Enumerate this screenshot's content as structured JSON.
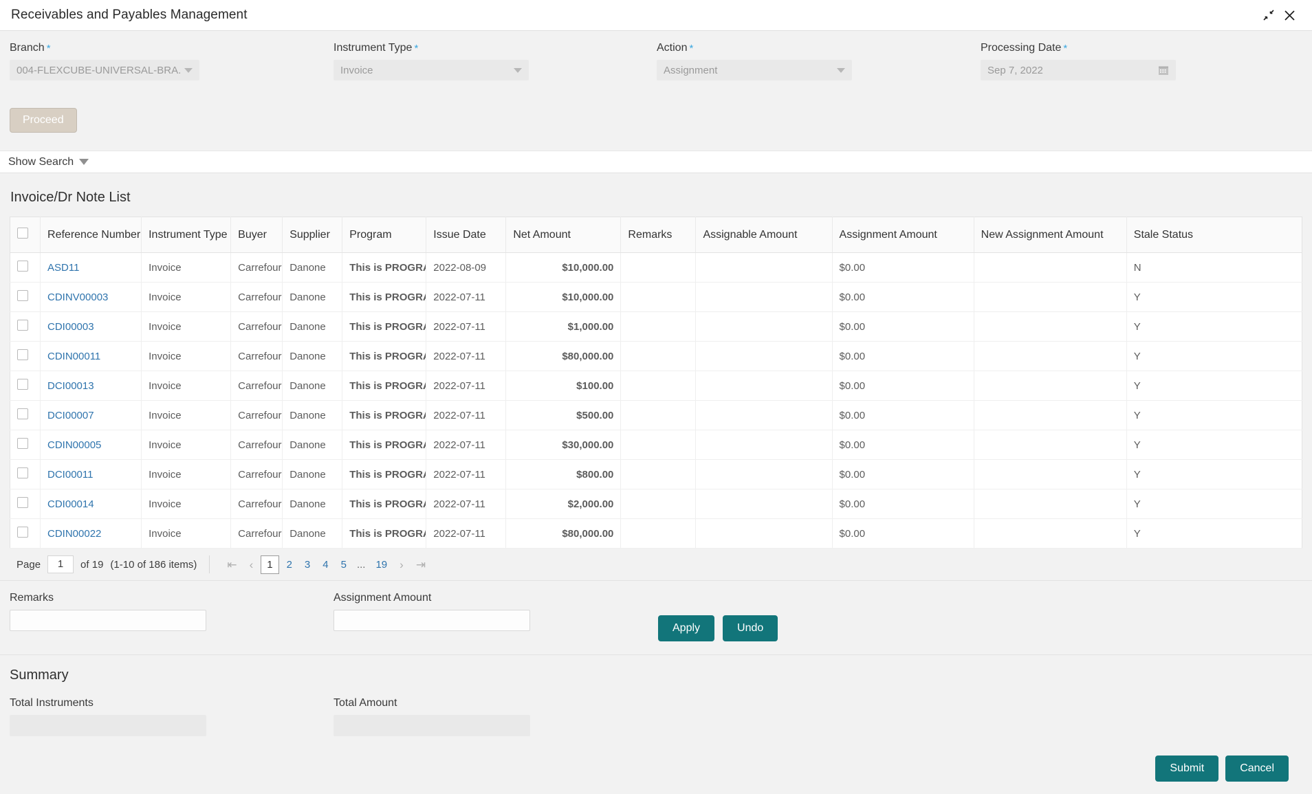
{
  "window": {
    "title": "Receivables and Payables Management",
    "minimize_icon": "collapse-arrows-icon",
    "close_icon": "close-icon"
  },
  "filters": {
    "branch": {
      "label": "Branch",
      "required": "*",
      "value": "004-FLEXCUBE-UNIVERSAL-BRA...",
      "icon": "chevron-down-icon"
    },
    "instrument_type": {
      "label": "Instrument Type",
      "required": "*",
      "value": "Invoice",
      "icon": "chevron-down-icon"
    },
    "action": {
      "label": "Action",
      "required": "*",
      "value": "Assignment",
      "icon": "chevron-down-icon"
    },
    "processing_date": {
      "label": "Processing Date",
      "required": "*",
      "value": "Sep 7, 2022",
      "icon": "calendar-icon"
    },
    "proceed_label": "Proceed"
  },
  "show_search": {
    "label": "Show Search",
    "icon": "triangle-down-icon"
  },
  "list": {
    "title": "Invoice/Dr Note List",
    "columns": [
      "Reference Number",
      "Instrument Type",
      "Buyer",
      "Supplier",
      "Program",
      "Issue Date",
      "Net Amount",
      "Remarks",
      "Assignable Amount",
      "Assignment Amount",
      "New Assignment Amount",
      "Stale Status"
    ],
    "rows": [
      {
        "ref": "ASD11",
        "instrument_type": "Invoice",
        "buyer": "Carrefour",
        "supplier": "Danone",
        "program": "This is PROGRA",
        "issue_date": "2022-08-09",
        "net_amount": "$10,000.00",
        "remarks": "",
        "assignable_amount": "",
        "assignment_amount": "$0.00",
        "new_assignment_amount": "",
        "stale_status": "N"
      },
      {
        "ref": "CDINV00003",
        "instrument_type": "Invoice",
        "buyer": "Carrefour",
        "supplier": "Danone",
        "program": "This is PROGRA",
        "issue_date": "2022-07-11",
        "net_amount": "$10,000.00",
        "remarks": "",
        "assignable_amount": "",
        "assignment_amount": "$0.00",
        "new_assignment_amount": "",
        "stale_status": "Y"
      },
      {
        "ref": "CDI00003",
        "instrument_type": "Invoice",
        "buyer": "Carrefour",
        "supplier": "Danone",
        "program": "This is PROGRA",
        "issue_date": "2022-07-11",
        "net_amount": "$1,000.00",
        "remarks": "",
        "assignable_amount": "",
        "assignment_amount": "$0.00",
        "new_assignment_amount": "",
        "stale_status": "Y"
      },
      {
        "ref": "CDIN00011",
        "instrument_type": "Invoice",
        "buyer": "Carrefour",
        "supplier": "Danone",
        "program": "This is PROGRA",
        "issue_date": "2022-07-11",
        "net_amount": "$80,000.00",
        "remarks": "",
        "assignable_amount": "",
        "assignment_amount": "$0.00",
        "new_assignment_amount": "",
        "stale_status": "Y"
      },
      {
        "ref": "DCI00013",
        "instrument_type": "Invoice",
        "buyer": "Carrefour",
        "supplier": "Danone",
        "program": "This is PROGRA",
        "issue_date": "2022-07-11",
        "net_amount": "$100.00",
        "remarks": "",
        "assignable_amount": "",
        "assignment_amount": "$0.00",
        "new_assignment_amount": "",
        "stale_status": "Y"
      },
      {
        "ref": "DCI00007",
        "instrument_type": "Invoice",
        "buyer": "Carrefour",
        "supplier": "Danone",
        "program": "This is PROGRA",
        "issue_date": "2022-07-11",
        "net_amount": "$500.00",
        "remarks": "",
        "assignable_amount": "",
        "assignment_amount": "$0.00",
        "new_assignment_amount": "",
        "stale_status": "Y"
      },
      {
        "ref": "CDIN00005",
        "instrument_type": "Invoice",
        "buyer": "Carrefour",
        "supplier": "Danone",
        "program": "This is PROGRA",
        "issue_date": "2022-07-11",
        "net_amount": "$30,000.00",
        "remarks": "",
        "assignable_amount": "",
        "assignment_amount": "$0.00",
        "new_assignment_amount": "",
        "stale_status": "Y"
      },
      {
        "ref": "DCI00011",
        "instrument_type": "Invoice",
        "buyer": "Carrefour",
        "supplier": "Danone",
        "program": "This is PROGRA",
        "issue_date": "2022-07-11",
        "net_amount": "$800.00",
        "remarks": "",
        "assignable_amount": "",
        "assignment_amount": "$0.00",
        "new_assignment_amount": "",
        "stale_status": "Y"
      },
      {
        "ref": "CDI00014",
        "instrument_type": "Invoice",
        "buyer": "Carrefour",
        "supplier": "Danone",
        "program": "This is PROGRA",
        "issue_date": "2022-07-11",
        "net_amount": "$2,000.00",
        "remarks": "",
        "assignable_amount": "",
        "assignment_amount": "$0.00",
        "new_assignment_amount": "",
        "stale_status": "Y"
      },
      {
        "ref": "CDIN00022",
        "instrument_type": "Invoice",
        "buyer": "Carrefour",
        "supplier": "Danone",
        "program": "This is PROGRA",
        "issue_date": "2022-07-11",
        "net_amount": "$80,000.00",
        "remarks": "",
        "assignable_amount": "",
        "assignment_amount": "$0.00",
        "new_assignment_amount": "",
        "stale_status": "Y"
      }
    ]
  },
  "pagination": {
    "page_label": "Page",
    "page_value": "1",
    "of_label": "of 19",
    "items_label": "(1-10 of 186 items)",
    "first_icon": "first-page-icon",
    "prev_icon": "prev-page-icon",
    "next_icon": "next-page-icon",
    "last_icon": "last-page-icon",
    "pages": [
      "1",
      "2",
      "3",
      "4",
      "5"
    ],
    "ellipsis": "...",
    "last_page": "19",
    "active_page": "1"
  },
  "edit_row": {
    "remarks_label": "Remarks",
    "remarks_value": "",
    "assignment_amount_label": "Assignment Amount",
    "assignment_amount_value": "",
    "apply_label": "Apply",
    "undo_label": "Undo"
  },
  "summary": {
    "title": "Summary",
    "total_instruments_label": "Total Instruments",
    "total_instruments_value": "",
    "total_amount_label": "Total Amount",
    "total_amount_value": ""
  },
  "footer": {
    "submit_label": "Submit",
    "cancel_label": "Cancel"
  },
  "colors": {
    "accent_teal": "#12757a",
    "link_blue": "#2f74ad",
    "required_star": "#3ba7e0",
    "proceed_disabled": "#d8cfc3"
  }
}
